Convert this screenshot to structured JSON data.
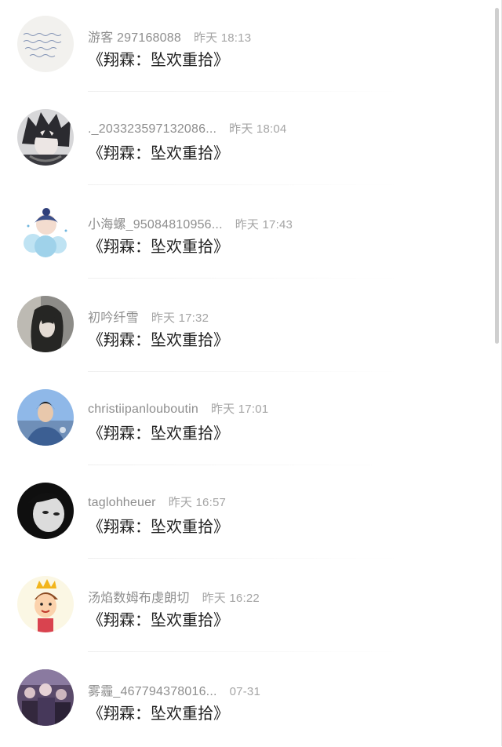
{
  "comments": [
    {
      "user": "游客 297168088",
      "time": "昨天 18:13",
      "text": "《翔霖：坠欢重拾》",
      "avatar": "handwritten-note-avatar"
    },
    {
      "user": "._203323597132086...",
      "time": "昨天 18:04",
      "text": "《翔霖：坠欢重拾》",
      "avatar": "anime-dark-hair-avatar"
    },
    {
      "user": "小海螺_95084810956...",
      "time": "昨天 17:43",
      "text": "《翔霖：坠欢重拾》",
      "avatar": "cartoon-blue-avatar"
    },
    {
      "user": "初吟纤雪",
      "time": "昨天 17:32",
      "text": "《翔霖：坠欢重拾》",
      "avatar": "girl-photo-avatar"
    },
    {
      "user": "christiipanlouboutin",
      "time": "昨天 17:01",
      "text": "《翔霖：坠欢重拾》",
      "avatar": "boy-blue-sky-avatar"
    },
    {
      "user": "taglohheuer",
      "time": "昨天 16:57",
      "text": "《翔霖：坠欢重拾》",
      "avatar": "bw-portrait-avatar"
    },
    {
      "user": "汤焰数姆布虔朗切",
      "time": "昨天 16:22",
      "text": "《翔霖：坠欢重拾》",
      "avatar": "cartoon-crown-avatar"
    },
    {
      "user": "雾霾_467794378016...",
      "time": "07-31",
      "text": "《翔霖：坠欢重拾》",
      "avatar": "crowd-photo-avatar"
    }
  ],
  "colors": {
    "username": "#8e8e8e",
    "time": "#a5a5a5",
    "comment": "#1f1f1f"
  }
}
